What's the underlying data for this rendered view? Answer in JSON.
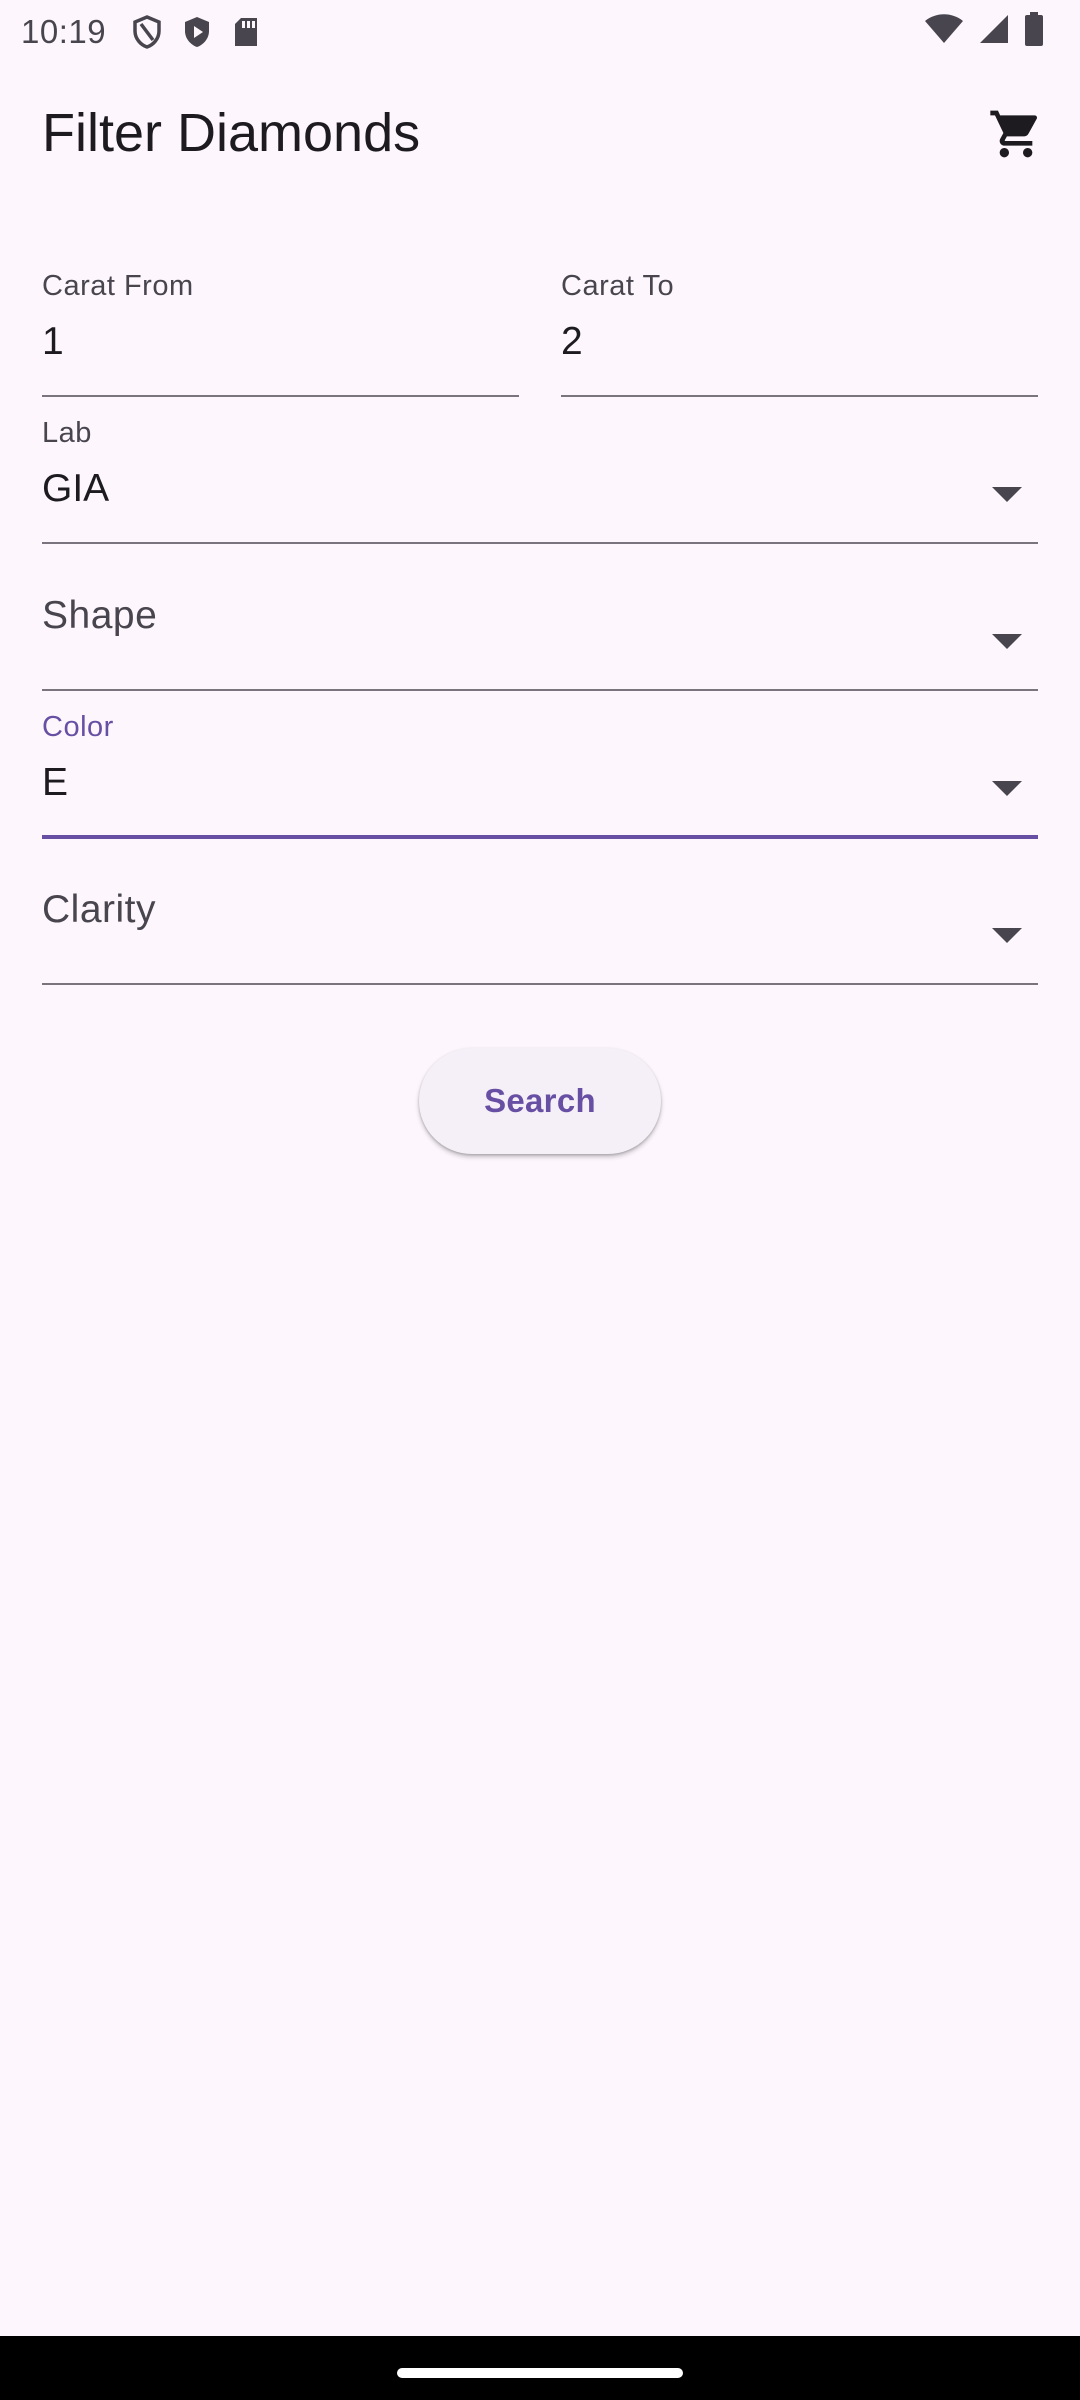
{
  "status_bar": {
    "time": "10:19",
    "left_icons": [
      "shield-outline-icon",
      "shield-play-icon",
      "sd-card-icon"
    ],
    "right_icons": [
      "wifi-icon",
      "signal-icon",
      "battery-icon"
    ]
  },
  "app_bar": {
    "title": "Filter Diamonds",
    "action_icon": "shopping-cart-icon"
  },
  "form": {
    "carat_from": {
      "label": "Carat From",
      "value": "1"
    },
    "carat_to": {
      "label": "Carat To",
      "value": "2"
    },
    "lab": {
      "label": "Lab",
      "value": "GIA"
    },
    "shape": {
      "label": "Shape",
      "value": ""
    },
    "color": {
      "label": "Color",
      "value": "E",
      "focused": true
    },
    "clarity": {
      "label": "Clarity",
      "value": ""
    }
  },
  "search_button": {
    "label": "Search"
  },
  "colors": {
    "background": "#fdf7fd",
    "accent": "#6750a4",
    "text": "#1d1b20",
    "muted": "#49454f"
  }
}
